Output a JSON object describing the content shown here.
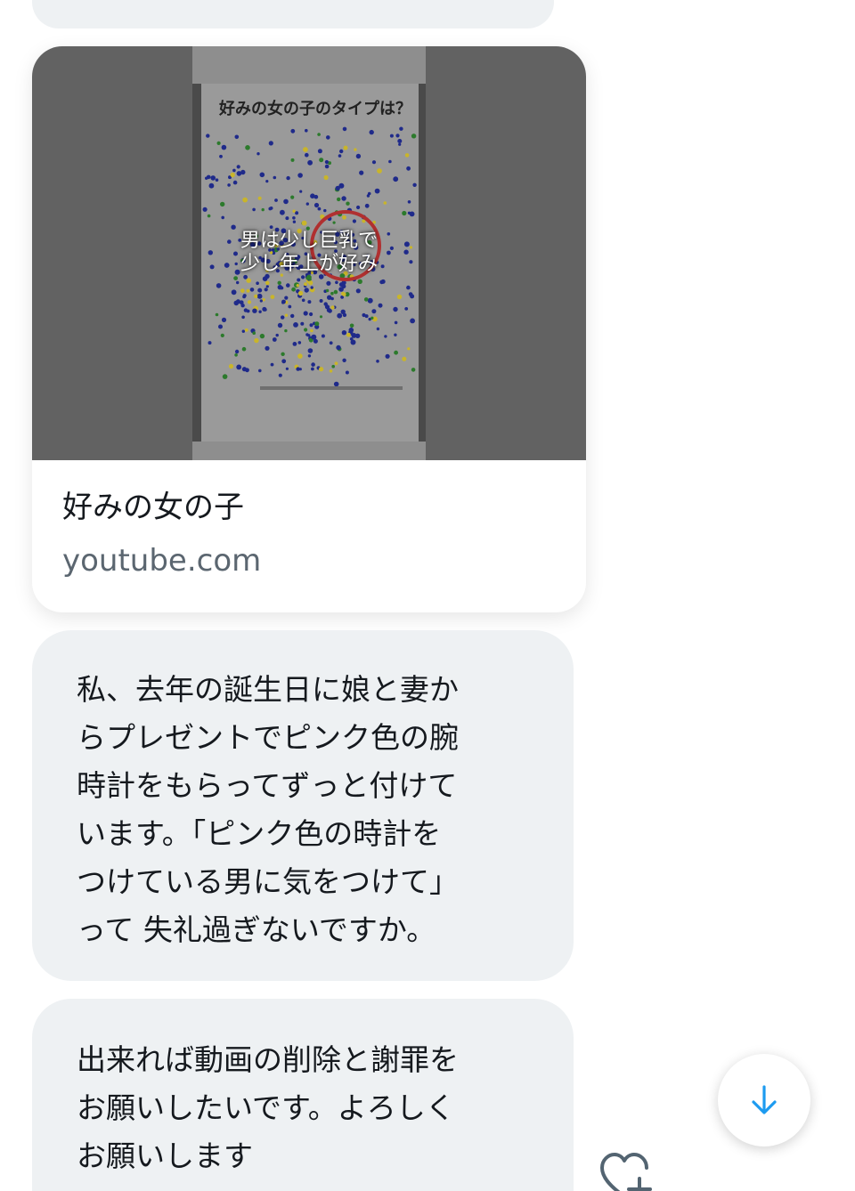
{
  "link_card": {
    "thumbnail": {
      "poster_title": "好みの女の子のタイプは？",
      "caption_line1": "男は少し巨乳で",
      "caption_line2": "少し年上が好み"
    },
    "title": "好みの女の子",
    "domain": "youtube.com"
  },
  "messages": [
    {
      "lines": [
        "私、去年の誕生日に娘と妻か",
        "らプレゼントでピンク色の腕",
        "時計をもらってずっと付けて",
        "います。「ピンク色の時計を",
        "つけている男に気をつけて」",
        "って 失礼過ぎないですか。"
      ]
    },
    {
      "lines": [
        "出来れば動画の削除と謝罪を",
        "お願いしたいです。よろしく",
        "お願いします"
      ]
    }
  ],
  "icons": {
    "scroll_down": "arrow-down-icon",
    "reaction": "heart-plus-icon"
  },
  "colors": {
    "bubble": "#eef1f3",
    "text": "#15191e",
    "muted": "#5b6670",
    "accent": "#1d9bf0"
  }
}
